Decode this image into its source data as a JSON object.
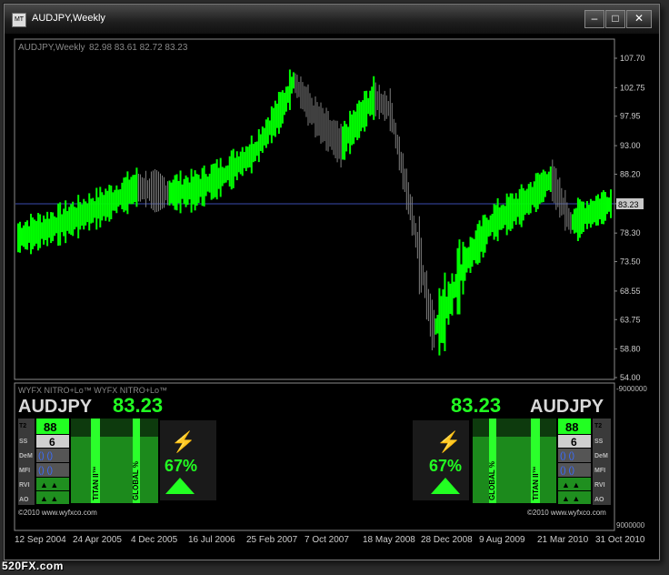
{
  "window": {
    "title": "AUDJPY,Weekly"
  },
  "chart": {
    "header": "AUDJPY,Weekly",
    "ohlc": "82.98 83.61 82.72 83.23",
    "current_price_label": "83.23",
    "y_ticks": [
      "107.70",
      "102.75",
      "97.95",
      "93.00",
      "88.20",
      "83.23",
      "78.30",
      "73.50",
      "68.55",
      "63.75",
      "58.80",
      "54.00"
    ],
    "x_ticks": [
      "12 Sep 2004",
      "24 Apr 2005",
      "4 Dec 2005",
      "16 Jul 2006",
      "25 Feb 2007",
      "7 Oct 2007",
      "18 May 2008",
      "28 Dec 2008",
      "9 Aug 2009",
      "21 Mar 2010",
      "31 Oct 2010"
    ]
  },
  "chart_data": {
    "type": "line",
    "title": "AUDJPY,Weekly",
    "ylim": [
      54.0,
      107.7
    ],
    "x": [
      "2004-09-12",
      "2005-01-01",
      "2005-04-24",
      "2005-09-01",
      "2005-12-04",
      "2006-04-01",
      "2006-07-16",
      "2006-11-01",
      "2007-02-25",
      "2007-06-15",
      "2007-07-20",
      "2007-10-07",
      "2008-01-15",
      "2008-05-18",
      "2008-07-20",
      "2008-10-15",
      "2008-12-28",
      "2009-02-01",
      "2009-05-01",
      "2009-08-09",
      "2009-12-01",
      "2010-03-21",
      "2010-06-01",
      "2010-10-31"
    ],
    "series": [
      {
        "values": [
          77.5,
          79.0,
          81.0,
          83.5,
          86.0,
          85.0,
          85.5,
          88.0,
          92.0,
          100.0,
          104.0,
          98.0,
          93.0,
          101.0,
          99.0,
          80.0,
          62.0,
          64.0,
          73.5,
          80.0,
          83.0,
          87.5,
          80.0,
          83.23
        ]
      }
    ],
    "trend_up_segments": true
  },
  "indicator": {
    "label": "WYFX NITRO+Lo™  WYFX NITRO+Lo™",
    "y_top": "-9000000",
    "y_bottom": "9000000",
    "copyright": "©2010 www.wyfxco.com",
    "left": {
      "symbol": "AUDJPY",
      "price": "83.23",
      "value1": "88",
      "value2": "6",
      "percent": "67%",
      "rows": [
        "T2",
        "SS",
        "DeM",
        "MFI",
        "RVI",
        "AO"
      ],
      "titan": "TITAN II™",
      "global": "GLOBAL %"
    },
    "right": {
      "symbol": "AUDJPY",
      "price": "83.23",
      "value1": "88",
      "value2": "6",
      "percent": "67%",
      "rows": [
        "T2",
        "SS",
        "DeM",
        "MFI",
        "RVI",
        "AO"
      ],
      "titan": "TITAN II™",
      "global": "GLOBAL %"
    }
  },
  "footer": {
    "brand": "520FX.com"
  },
  "colors": {
    "bull": "#00ff00",
    "bear": "#808080",
    "bg": "#000000",
    "price_line": "#3a4bb0"
  }
}
